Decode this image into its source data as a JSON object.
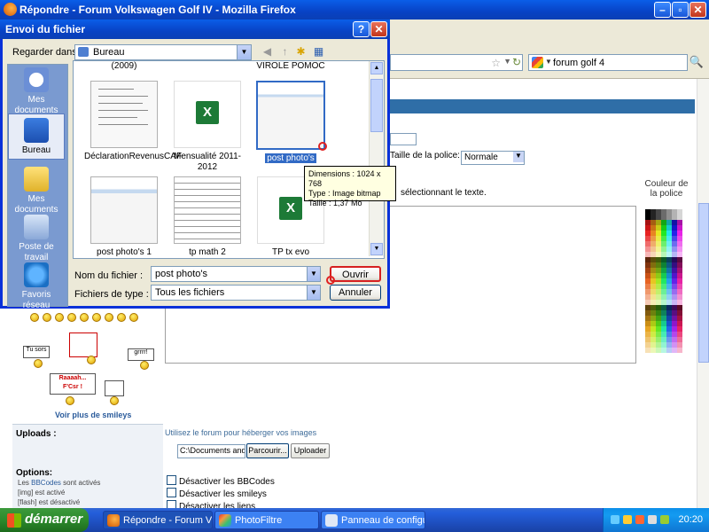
{
  "browser": {
    "title": "Répondre - Forum Volkswagen Golf IV - Mozilla Firefox",
    "search_value": "forum golf 4"
  },
  "page": {
    "font_size_label": "Taille de la police:",
    "font_size_value": "Normale",
    "select_text_hint": "sélectionnant le texte.",
    "font_color_label": "Couleur de la police",
    "more_smileys": "Voir plus de smileys",
    "sign_tu_sors": "Tu sors",
    "sign_grrrr": "grrrr!",
    "sign_raaah": "Raaaah...",
    "sign_fcsr": "F'Csr !",
    "uploads_label": "Uploads :",
    "uploads_hint": "Utilisez le forum pour héberger vos images",
    "upload_path": "C:\\Documents and Set",
    "browse_button": "Parcourir...",
    "uploader_button": "Uploader",
    "options_label": "Options:",
    "option_bbcodes_link": "BBCodes",
    "option_bbcodes_prefix": "Les ",
    "option_bbcodes_suffix": " sont activés",
    "option_img": "[img] est activé",
    "option_flash": "[flash] est désactivé",
    "check_bbcodes": "Désactiver les BBCodes",
    "check_smileys": "Désactiver les smileys",
    "check_links": "Désactiver les liens"
  },
  "dialog": {
    "title": "Envoi du fichier",
    "look_in_label": "Regarder dans :",
    "look_in_value": "Bureau",
    "places": [
      {
        "label": "Mes documents récents"
      },
      {
        "label": "Bureau"
      },
      {
        "label": "Mes documents"
      },
      {
        "label": "Poste de travail"
      },
      {
        "label": "Favoris réseau"
      }
    ],
    "partial_top_left": "(2009)",
    "partial_top_right": "VIROLE POMOC",
    "files": [
      {
        "name": "DéclarationRevenusCAF"
      },
      {
        "name": "Mensualité 2011-2012"
      },
      {
        "name": "post photo's"
      },
      {
        "name": "post photo's 1"
      },
      {
        "name": "tp math 2"
      },
      {
        "name": "TP tx evo"
      }
    ],
    "tooltip": {
      "dimensions": "Dimensions : 1024 x 768",
      "type": "Type : Image bitmap",
      "size": "Taille : 1,37 Mo"
    },
    "filename_label": "Nom du fichier :",
    "filename_value": "post photo's",
    "filetype_label": "Fichiers de type :",
    "filetype_value": "Tous les fichiers",
    "open_button": "Ouvrir",
    "cancel_button": "Annuler"
  },
  "taskbar": {
    "start_label": "démarrer",
    "tasks": [
      {
        "label": "Répondre - Forum Vol..."
      },
      {
        "label": "PhotoFiltre"
      },
      {
        "label": "Panneau de configur..."
      }
    ],
    "clock": "20:20"
  },
  "colors": {
    "xp_blue": "#0a5ee8",
    "selection": "#316ac5",
    "start_green": "#2c8a2c"
  }
}
